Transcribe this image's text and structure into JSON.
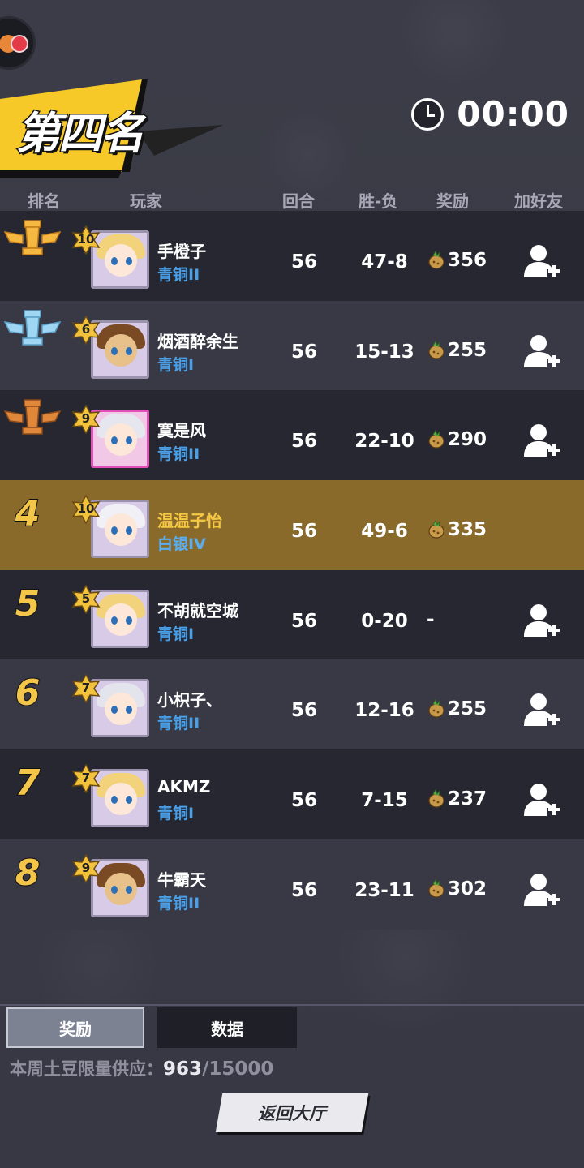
{
  "title": {
    "placement": "第四名"
  },
  "timer": {
    "icon": "clock-icon",
    "value": "00:00"
  },
  "columns": {
    "rank": "排名",
    "player": "玩家",
    "rounds": "回合",
    "winloss": "胜-负",
    "reward": "奖励",
    "add_friend": "加好友"
  },
  "players": [
    {
      "rank": "1",
      "rank_badge": "gold-trophy-icon",
      "level": "10",
      "name": "手橙子",
      "tier": "青铜II",
      "rounds": "56",
      "winloss": "47-8",
      "reward": "356",
      "add_friend": true
    },
    {
      "rank": "2",
      "rank_badge": "silver-trophy-icon",
      "level": "6",
      "name": "烟酒醉余生",
      "tier": "青铜I",
      "rounds": "56",
      "winloss": "15-13",
      "reward": "255",
      "add_friend": true
    },
    {
      "rank": "3",
      "rank_badge": "bronze-trophy-icon",
      "level": "9",
      "name": "寞是风",
      "tier": "青铜II",
      "rounds": "56",
      "winloss": "22-10",
      "reward": "290",
      "add_friend": true
    },
    {
      "rank": "4",
      "level": "10",
      "name": "温温子怡",
      "tier": "白银IV",
      "rounds": "56",
      "winloss": "49-6",
      "reward": "335",
      "add_friend": false
    },
    {
      "rank": "5",
      "level": "5",
      "name": "不胡就空城",
      "tier": "青铜I",
      "rounds": "56",
      "winloss": "0-20",
      "reward": "-",
      "add_friend": true
    },
    {
      "rank": "6",
      "level": "7",
      "name": "小枳子、",
      "tier": "青铜II",
      "rounds": "56",
      "winloss": "12-16",
      "reward": "255",
      "add_friend": true
    },
    {
      "rank": "7",
      "level": "7",
      "name": "AKMZ",
      "tier": "青铜I",
      "rounds": "56",
      "winloss": "7-15",
      "reward": "237",
      "add_friend": true
    },
    {
      "rank": "8",
      "level": "9",
      "name": "牛霸天",
      "tier": "青铜II",
      "rounds": "56",
      "winloss": "23-11",
      "reward": "302",
      "add_friend": true
    }
  ],
  "tabs": {
    "reward": "奖励",
    "data": "数据"
  },
  "supply": {
    "label": "本周土豆限量供应：",
    "current": "963",
    "max": "/15000"
  },
  "return_button": "返回大厅",
  "colors": {
    "my_row": "#8a6a2a",
    "tier_blue": "#4a9fe6",
    "rank_gold": "#f3c64a"
  }
}
